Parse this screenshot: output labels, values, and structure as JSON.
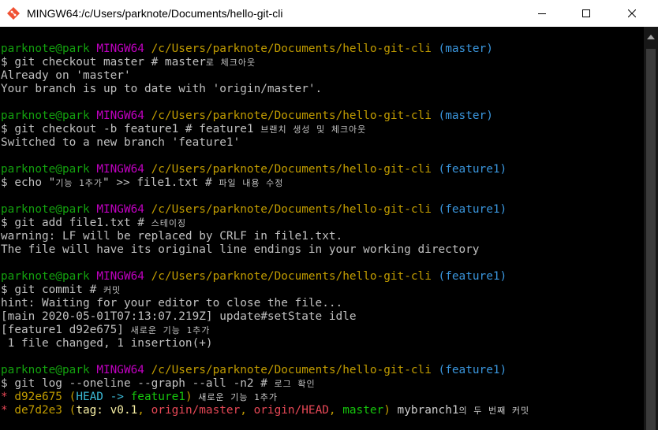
{
  "window": {
    "title": "MINGW64:/c/Users/parknote/Documents/hello-git-cli"
  },
  "colors": {
    "user": "#13a10e",
    "system": "#c000c0",
    "path": "#c19c00",
    "branch": "#3a96dd",
    "text": "#c0c0c0"
  },
  "icons": {
    "app": "git-bash-icon",
    "minimize": "minimize-icon",
    "maximize": "maximize-icon",
    "close": "close-icon"
  },
  "blocks": [
    {
      "prompt": {
        "user": "parknote@park",
        "system": "MINGW64",
        "path": "/c/Users/parknote/Documents/hello-git-cli",
        "branch": "(master)"
      },
      "command": "$ git checkout master # master",
      "comment_kr": "로 체크아웃",
      "output": [
        "Already on 'master'",
        "Your branch is up to date with 'origin/master'."
      ]
    },
    {
      "prompt": {
        "user": "parknote@park",
        "system": "MINGW64",
        "path": "/c/Users/parknote/Documents/hello-git-cli",
        "branch": "(master)"
      },
      "command": "$ git checkout -b feature1 # feature1 ",
      "comment_kr": "브랜치 생성 및 체크아웃",
      "output": [
        "Switched to a new branch 'feature1'"
      ]
    },
    {
      "prompt": {
        "user": "parknote@park",
        "system": "MINGW64",
        "path": "/c/Users/parknote/Documents/hello-git-cli",
        "branch": "(feature1)"
      },
      "command_a": "$ echo \"",
      "command_kr_a": "기능 1추가",
      "command_b": "\" >> file1.txt # ",
      "command_kr_b": "파일 내용 수정"
    },
    {
      "prompt": {
        "user": "parknote@park",
        "system": "MINGW64",
        "path": "/c/Users/parknote/Documents/hello-git-cli",
        "branch": "(feature1)"
      },
      "command": "$ git add file1.txt # ",
      "comment_kr": "스테이징",
      "output": [
        "warning: LF will be replaced by CRLF in file1.txt.",
        "The file will have its original line endings in your working directory"
      ]
    },
    {
      "prompt": {
        "user": "parknote@park",
        "system": "MINGW64",
        "path": "/c/Users/parknote/Documents/hello-git-cli",
        "branch": "(feature1)"
      },
      "command": "$ git commit # ",
      "comment_kr": "커밋",
      "output": [
        "hint: Waiting for your editor to close the file...",
        "[main 2020-05-01T07:13:07.219Z] update#setState idle"
      ],
      "commit_line": "[feature1 d92e675] ",
      "commit_msg_kr": "새로운 기능 1추가",
      "summary": " 1 file changed, 1 insertion(+)"
    },
    {
      "prompt": {
        "user": "parknote@park",
        "system": "MINGW64",
        "path": "/c/Users/parknote/Documents/hello-git-cli",
        "branch": "(feature1)"
      },
      "command": "$ git log --oneline --graph --all -n2 # ",
      "comment_kr": "로그 확인"
    }
  ],
  "log": [
    {
      "star": "* ",
      "hash": "d92e675",
      "refs_open": " (",
      "head": "HEAD -> ",
      "branch": "feature1",
      "refs_close": ")",
      "msg_kr": " 새로운 기능 1추가"
    },
    {
      "star": "* ",
      "hash": "de7d2e3",
      "refs_open": " (",
      "tag": "tag: v0.1",
      "sep1": ", ",
      "remote1": "origin/master",
      "sep2": ", ",
      "remote2": "origin/HEAD",
      "sep3": ", ",
      "local": "master",
      "refs_close": ")",
      "msg": " mybranch1",
      "msg_kr": "의 두 번째 커밋"
    }
  ]
}
